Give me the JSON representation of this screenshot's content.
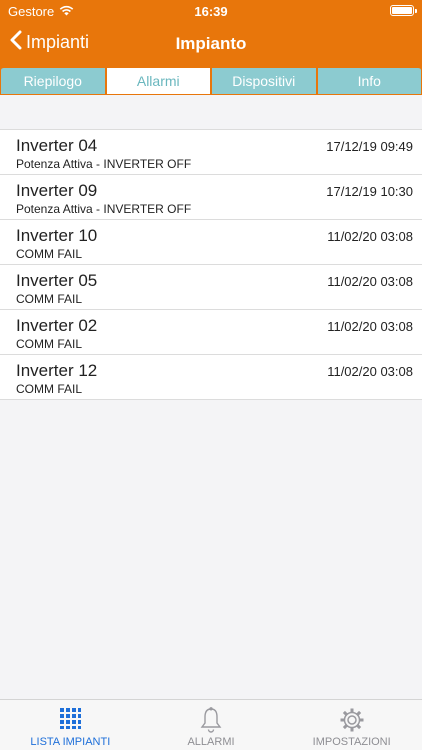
{
  "status_bar": {
    "carrier": "Gestore",
    "time": "16:39"
  },
  "navbar": {
    "back_label": "Impianti",
    "title": "Impianto"
  },
  "segments": [
    {
      "label": "Riepilogo",
      "active": false
    },
    {
      "label": "Allarmi",
      "active": true
    },
    {
      "label": "Dispositivi",
      "active": false
    },
    {
      "label": "Info",
      "active": false
    }
  ],
  "alarms": [
    {
      "title": "Inverter 04",
      "subtitle": "Potenza Attiva - INVERTER OFF",
      "date": "17/12/19 09:49"
    },
    {
      "title": "Inverter 09",
      "subtitle": "Potenza Attiva - INVERTER OFF",
      "date": "17/12/19 10:30"
    },
    {
      "title": "Inverter 10",
      "subtitle": "COMM FAIL",
      "date": "11/02/20 03:08"
    },
    {
      "title": "Inverter 05",
      "subtitle": "COMM FAIL",
      "date": "11/02/20 03:08"
    },
    {
      "title": "Inverter 02",
      "subtitle": "COMM FAIL",
      "date": "11/02/20 03:08"
    },
    {
      "title": "Inverter 12",
      "subtitle": "COMM FAIL",
      "date": "11/02/20 03:08"
    }
  ],
  "tabbar": [
    {
      "label": "LISTA IMPIANTI",
      "icon": "grid-icon",
      "active": true
    },
    {
      "label": "ALLARMI",
      "icon": "bell-icon",
      "active": false
    },
    {
      "label": "IMPOSTAZIONI",
      "icon": "gear-icon",
      "active": false
    }
  ],
  "colors": {
    "header": "#e8760b",
    "segment": "#8ccbd0",
    "segment_active_text": "#6ab7be",
    "tab_active": "#1e6fd9",
    "tab_inactive": "#8e8e93"
  }
}
